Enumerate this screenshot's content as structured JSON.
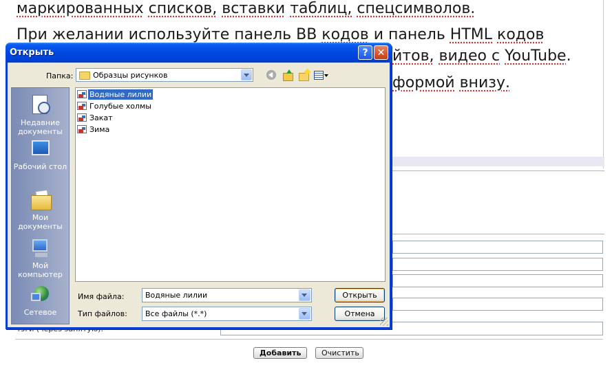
{
  "background_page": {
    "line1": [
      "маркированных",
      "списков,",
      "вставки",
      "таблиц,",
      "спецсимволов."
    ],
    "line2_left": [
      "При желании используйте панель",
      "BB",
      "кодов",
      "и панель",
      "HTML",
      "кодов"
    ],
    "line3_right": [
      "йтов,",
      "видео с",
      "YouTube",
      "."
    ],
    "line4_right": [
      "формой",
      "внизу."
    ],
    "bottom_field_label": "тэги (через запятую):",
    "buttons": {
      "add": "Добавить",
      "clear": "Очистить"
    }
  },
  "dialog": {
    "title": "Открыть",
    "help_glyph": "?",
    "close_glyph": "✕",
    "lookin": {
      "label": "Папка:",
      "value": "Образцы рисунков"
    },
    "places": [
      {
        "label": "Недавние документы",
        "icon": "recent-documents-icon"
      },
      {
        "label": "Рабочий стол",
        "icon": "desktop-icon"
      },
      {
        "label": "Мои документы",
        "icon": "my-documents-icon"
      },
      {
        "label": "Мой компьютер",
        "icon": "my-computer-icon"
      },
      {
        "label": "Сетевое",
        "icon": "network-icon"
      }
    ],
    "files": [
      {
        "name": "Водяные лилии",
        "selected": true
      },
      {
        "name": "Голубые холмы",
        "selected": false
      },
      {
        "name": "Закат",
        "selected": false
      },
      {
        "name": "Зима",
        "selected": false
      }
    ],
    "filename": {
      "label": "Имя файла:",
      "value": "Водяные лилии"
    },
    "filetype": {
      "label": "Тип файлов:",
      "value": "Все файлы (*.*)"
    },
    "buttons": {
      "open": "Открыть",
      "cancel": "Отмена"
    }
  },
  "colors": {
    "titlebar": "#0048e0",
    "selection": "#316ac5",
    "dialog_face": "#ece9d8",
    "places_bar": "#8e98b5",
    "spellcheck_underline": "#d83030"
  }
}
